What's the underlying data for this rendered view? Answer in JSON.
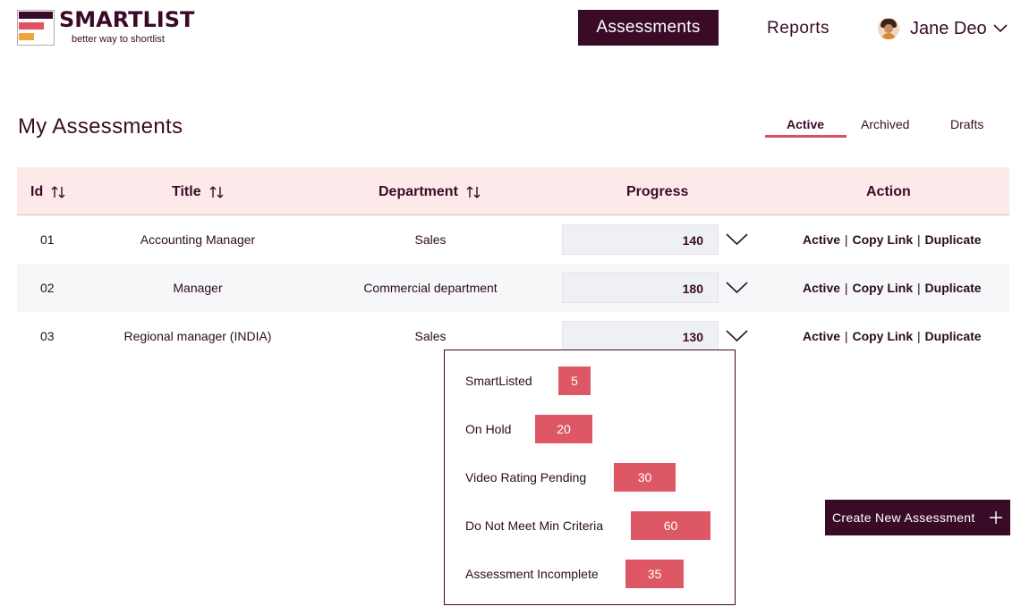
{
  "brand": {
    "name": "SMARTLIST",
    "tagline": "better way to shortlist",
    "colors": {
      "primary": "#3a0b27",
      "accent": "#dd5864",
      "orange": "#f0a63a",
      "header_bg": "#fde9ea"
    }
  },
  "nav": {
    "assessments_label": "Assessments",
    "reports_label": "Reports"
  },
  "user": {
    "name": "Jane Deo",
    "avatar_icon": "avatar",
    "menu_icon": "chevron-down-icon"
  },
  "page": {
    "title": "My Assessments",
    "tabs": [
      {
        "label": "Active",
        "selected": true
      },
      {
        "label": "Archived",
        "selected": false
      },
      {
        "label": "Drafts",
        "selected": false
      }
    ]
  },
  "table": {
    "columns": [
      "Id",
      "Title",
      "Department",
      "Progress",
      "Action"
    ],
    "rows": [
      {
        "id": "01",
        "title": "Accounting Manager",
        "department": "Sales",
        "progress": "140",
        "actions": [
          "Active",
          "Copy Link",
          "Duplicate"
        ],
        "separator": "|"
      },
      {
        "id": "02",
        "title": "Manager",
        "department": "Commercial department",
        "progress": "180",
        "actions": [
          "Active",
          "Copy Link",
          "Duplicate"
        ],
        "separator": "|"
      },
      {
        "id": "03",
        "title": "Regional manager (INDIA)",
        "department": "Sales",
        "progress": "130",
        "actions": [
          "Active",
          "Copy Link",
          "Duplicate"
        ],
        "separator": "|"
      }
    ]
  },
  "progress_popup": {
    "items": [
      {
        "label": "SmartListed",
        "value": "5"
      },
      {
        "label": "On Hold",
        "value": "20"
      },
      {
        "label": "Video Rating Pending",
        "value": "30"
      },
      {
        "label": "Do Not Meet Min Criteria",
        "value": "60"
      },
      {
        "label": "Assessment Incomplete",
        "value": "35"
      }
    ]
  },
  "create_button": {
    "label": "Create New Assessment",
    "icon": "plus-icon"
  }
}
